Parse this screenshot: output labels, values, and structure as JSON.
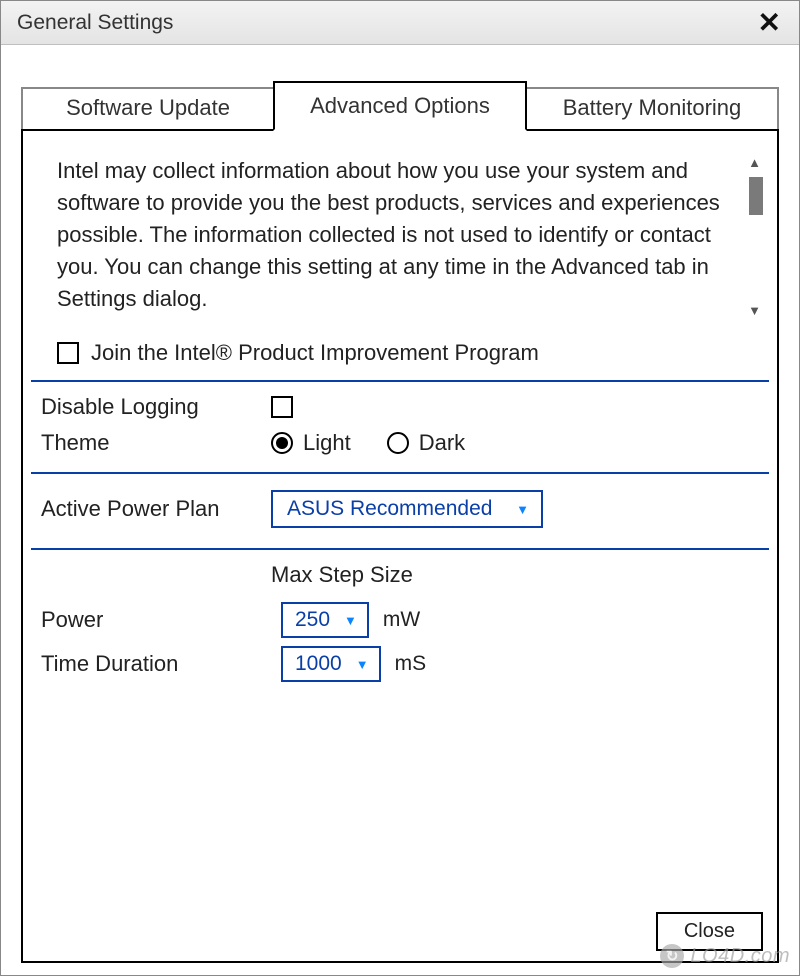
{
  "window": {
    "title": "General Settings"
  },
  "tabs": [
    {
      "label": "Software Update",
      "active": false
    },
    {
      "label": "Advanced Options",
      "active": true
    },
    {
      "label": "Battery Monitoring",
      "active": false
    }
  ],
  "advanced": {
    "description": "Intel may collect information about how you use your system and software to provide you the best products, services and experiences possible. The information collected is not used to identify or contact you. You can change this setting at any time in the Advanced tab in Settings dialog.",
    "join_program_label": "Join the Intel® Product Improvement Program",
    "join_program_checked": false,
    "disable_logging_label": "Disable Logging",
    "disable_logging_checked": false,
    "theme_label": "Theme",
    "theme_options": {
      "light": "Light",
      "dark": "Dark"
    },
    "theme_selected": "light",
    "active_power_plan_label": "Active Power Plan",
    "active_power_plan_value": "ASUS Recommended",
    "max_step_size_label": "Max Step Size",
    "power_label": "Power",
    "power_value": "250",
    "power_unit": "mW",
    "time_label": "Time Duration",
    "time_value": "1000",
    "time_unit": "mS"
  },
  "footer": {
    "close_label": "Close"
  },
  "watermark": {
    "text": "LO4D.com"
  }
}
